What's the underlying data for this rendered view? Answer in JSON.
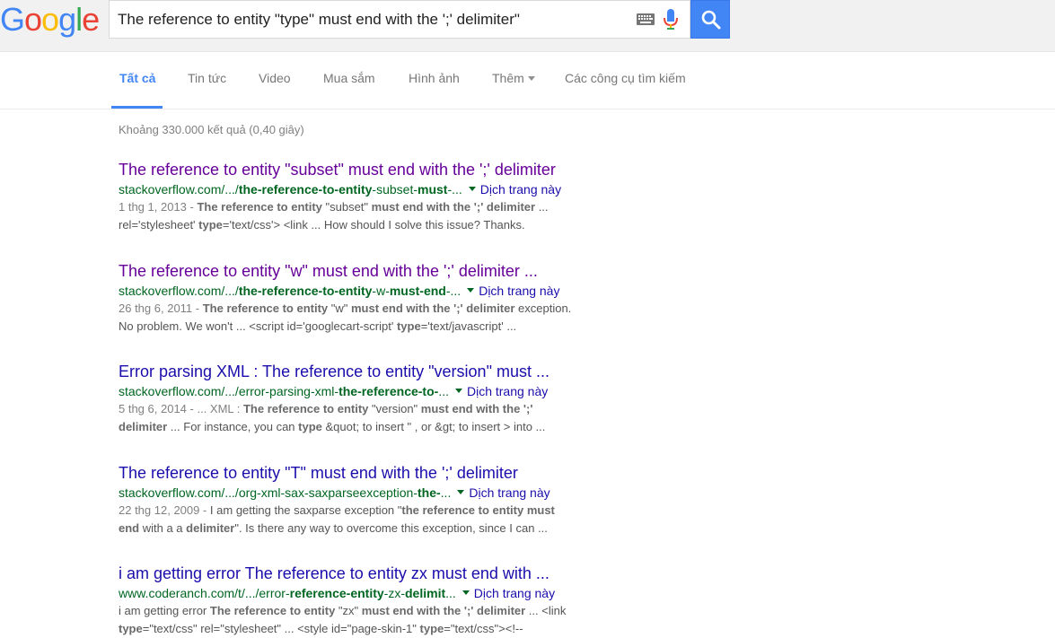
{
  "logo": {
    "letters": [
      "G",
      "o",
      "o",
      "g",
      "l",
      "e"
    ],
    "colors": [
      "#4285f4",
      "#ea4335",
      "#fbbc05",
      "#4285f4",
      "#34a853",
      "#ea4335"
    ]
  },
  "search": {
    "query": "The reference to entity \"type\" must end with the ';' delimiter\""
  },
  "tabs": [
    {
      "label": "Tất cả"
    },
    {
      "label": "Tin tức"
    },
    {
      "label": "Video"
    },
    {
      "label": "Mua sắm"
    },
    {
      "label": "Hình ảnh"
    },
    {
      "label": "Thêm"
    },
    {
      "label": "Các công cụ tìm kiếm"
    }
  ],
  "stats": "Khoảng 330.000 kết quả (0,40 giây)",
  "translate_label": "Dịch trang này",
  "results": [
    {
      "title": "The reference to entity \"subset\" must end with the ';' delimiter",
      "url_parts": [
        "stackoverflow.com/.../",
        "the-reference-to-entity",
        "-subset-",
        "must",
        "-..."
      ],
      "line1": [
        "1 thg 1, 2013 - ",
        "The reference to entity",
        " \"subset\" ",
        "must end with the ';' delimiter",
        " ..."
      ],
      "line2": [
        "rel='stylesheet' ",
        "type",
        "='text/css'> <link ... How should I solve this issue? Thanks."
      ]
    },
    {
      "title": "The reference to entity \"w\" must end with the ';' delimiter ...",
      "url_parts": [
        "stackoverflow.com/.../",
        "the-reference-to-entity",
        "-w-",
        "must-end",
        "-..."
      ],
      "line1": [
        "26 thg 6, 2011 - ",
        "The reference to entity",
        " \"w\" ",
        "must end with the ';' delimiter",
        " exception."
      ],
      "line2": [
        "No problem. We won't ... <script id='googlecart-script' ",
        "type",
        "='text/javascript' ..."
      ]
    },
    {
      "title": "Error parsing XML : The reference to entity \"version\" must ...",
      "url_parts": [
        "stackoverflow.com/.../error-parsing-xml-",
        "the-reference-to-",
        "",
        "",
        "..."
      ],
      "line1": [
        "5 thg 6, 2014 - ... XML : ",
        "The reference to entity",
        " \"version\" ",
        "must end with the ';'",
        ""
      ],
      "line2": [
        "",
        "delimiter",
        " ... For instance, you can ",
        "type",
        " &quot; to insert \" , or &gt; to insert > into ..."
      ]
    },
    {
      "title": "The reference to entity \"T\" must end with the ';' delimiter",
      "url_parts": [
        "stackoverflow.com/.../org-xml-sax-saxparseexception-",
        "the-",
        "",
        "",
        "..."
      ],
      "line1": [
        "22 thg 12, 2009 - ",
        "I am getting the saxparse exception \"",
        "the reference to entity must",
        "",
        ""
      ],
      "line2": [
        "",
        "end",
        " with a a ",
        "delimiter",
        "\". Is there any way to overcome this exception, since I can ..."
      ]
    },
    {
      "title": "i am getting error The reference to entity zx must end with ...",
      "url_parts": [
        "www.coderanch.com/t/.../error-",
        "reference-entity",
        "-zx-",
        "delimit",
        "..."
      ],
      "line1": [
        "",
        "i am getting error ",
        "The reference to entity",
        " \"zx\" ",
        "must end with the ';' delimiter",
        " ... <link"
      ],
      "line2": [
        "",
        "type",
        "=\"text/css\" rel=\"stylesheet\" ... <style id=\"page-skin-1\" ",
        "type",
        "=\"text/css\"><!--"
      ]
    }
  ]
}
